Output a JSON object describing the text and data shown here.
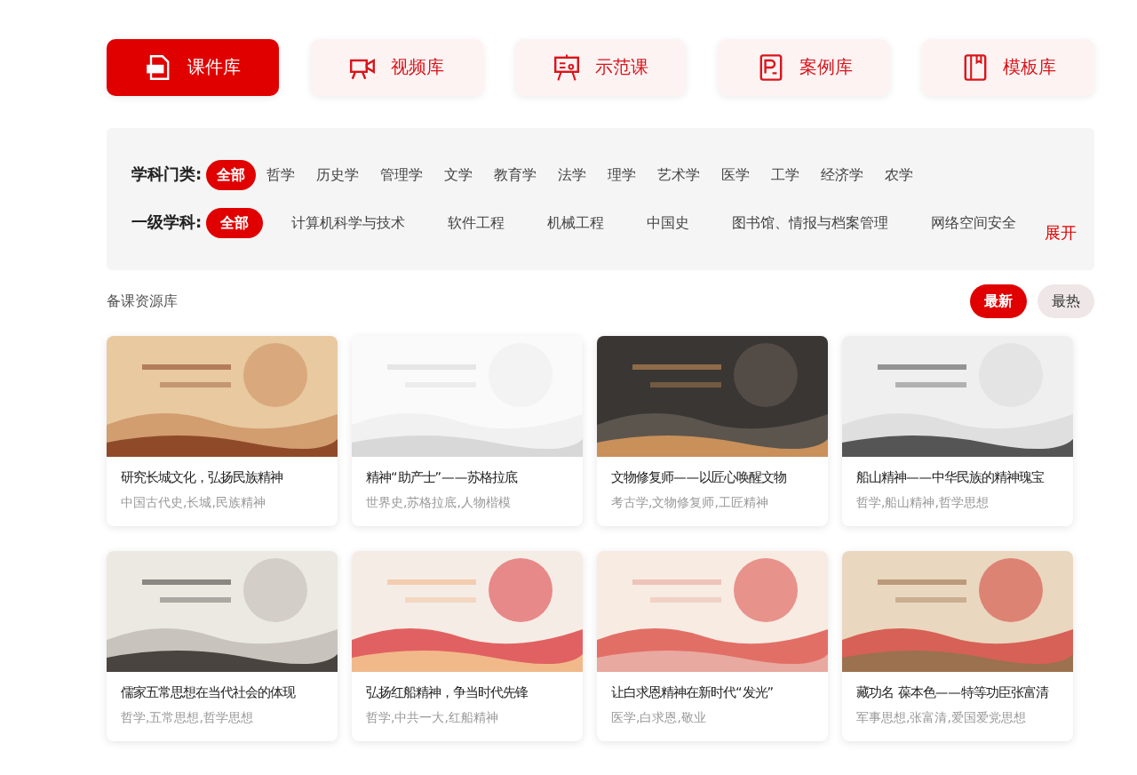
{
  "library_tabs": [
    {
      "label": "课件库",
      "selected": true
    },
    {
      "label": "视频库",
      "selected": false
    },
    {
      "label": "示范课",
      "selected": false
    },
    {
      "label": "案例库",
      "selected": false
    },
    {
      "label": "模板库",
      "selected": false
    }
  ],
  "filters": [
    {
      "label": "学科门类:",
      "options": [
        {
          "label": "全部",
          "selected": true
        },
        {
          "label": "哲学",
          "selected": false
        },
        {
          "label": "历史学",
          "selected": false
        },
        {
          "label": "管理学",
          "selected": false
        },
        {
          "label": "文学",
          "selected": false
        },
        {
          "label": "教育学",
          "selected": false
        },
        {
          "label": "法学",
          "selected": false
        },
        {
          "label": "理学",
          "selected": false
        },
        {
          "label": "艺术学",
          "selected": false
        },
        {
          "label": "医学",
          "selected": false
        },
        {
          "label": "工学",
          "selected": false
        },
        {
          "label": "经济学",
          "selected": false
        },
        {
          "label": "农学",
          "selected": false
        }
      ]
    },
    {
      "label": "一级学科:",
      "options": [
        {
          "label": "全部",
          "selected": true
        },
        {
          "label": "计算机科学与技术",
          "selected": false
        },
        {
          "label": "软件工程",
          "selected": false
        },
        {
          "label": "机械工程",
          "selected": false
        },
        {
          "label": "中国史",
          "selected": false
        },
        {
          "label": "图书馆、情报与档案管理",
          "selected": false
        },
        {
          "label": "网络空间安全",
          "selected": false
        }
      ]
    }
  ],
  "expand_link": "展开",
  "section_title": "备课资源库",
  "sort_buttons": [
    {
      "label": "最新",
      "selected": true
    },
    {
      "label": "最热",
      "selected": false
    }
  ],
  "cards": [
    {
      "title": "研究长城文化，弘扬民族精神",
      "tags": "中国古代史,长城,民族精神"
    },
    {
      "title": "精神“助产士”——苏格拉底",
      "tags": "世界史,苏格拉底,人物楷模"
    },
    {
      "title": "文物修复师——以匠心唤醒文物",
      "tags": "考古学,文物修复师,工匠精神"
    },
    {
      "title": "船山精神——中华民族的精神瑰宝",
      "tags": "哲学,船山精神,哲学思想"
    },
    {
      "title": "儒家五常思想在当代社会的体现",
      "tags": "哲学,五常思想,哲学思想"
    },
    {
      "title": "弘扬红船精神，争当时代先锋",
      "tags": "哲学,中共一大,红船精神"
    },
    {
      "title": "让白求恩精神在新时代“发光”",
      "tags": "医学,白求恩,敬业"
    },
    {
      "title": "藏功名 葆本色——特等功臣张富清",
      "tags": "军事思想,张富清,爱国爱党思想"
    }
  ]
}
